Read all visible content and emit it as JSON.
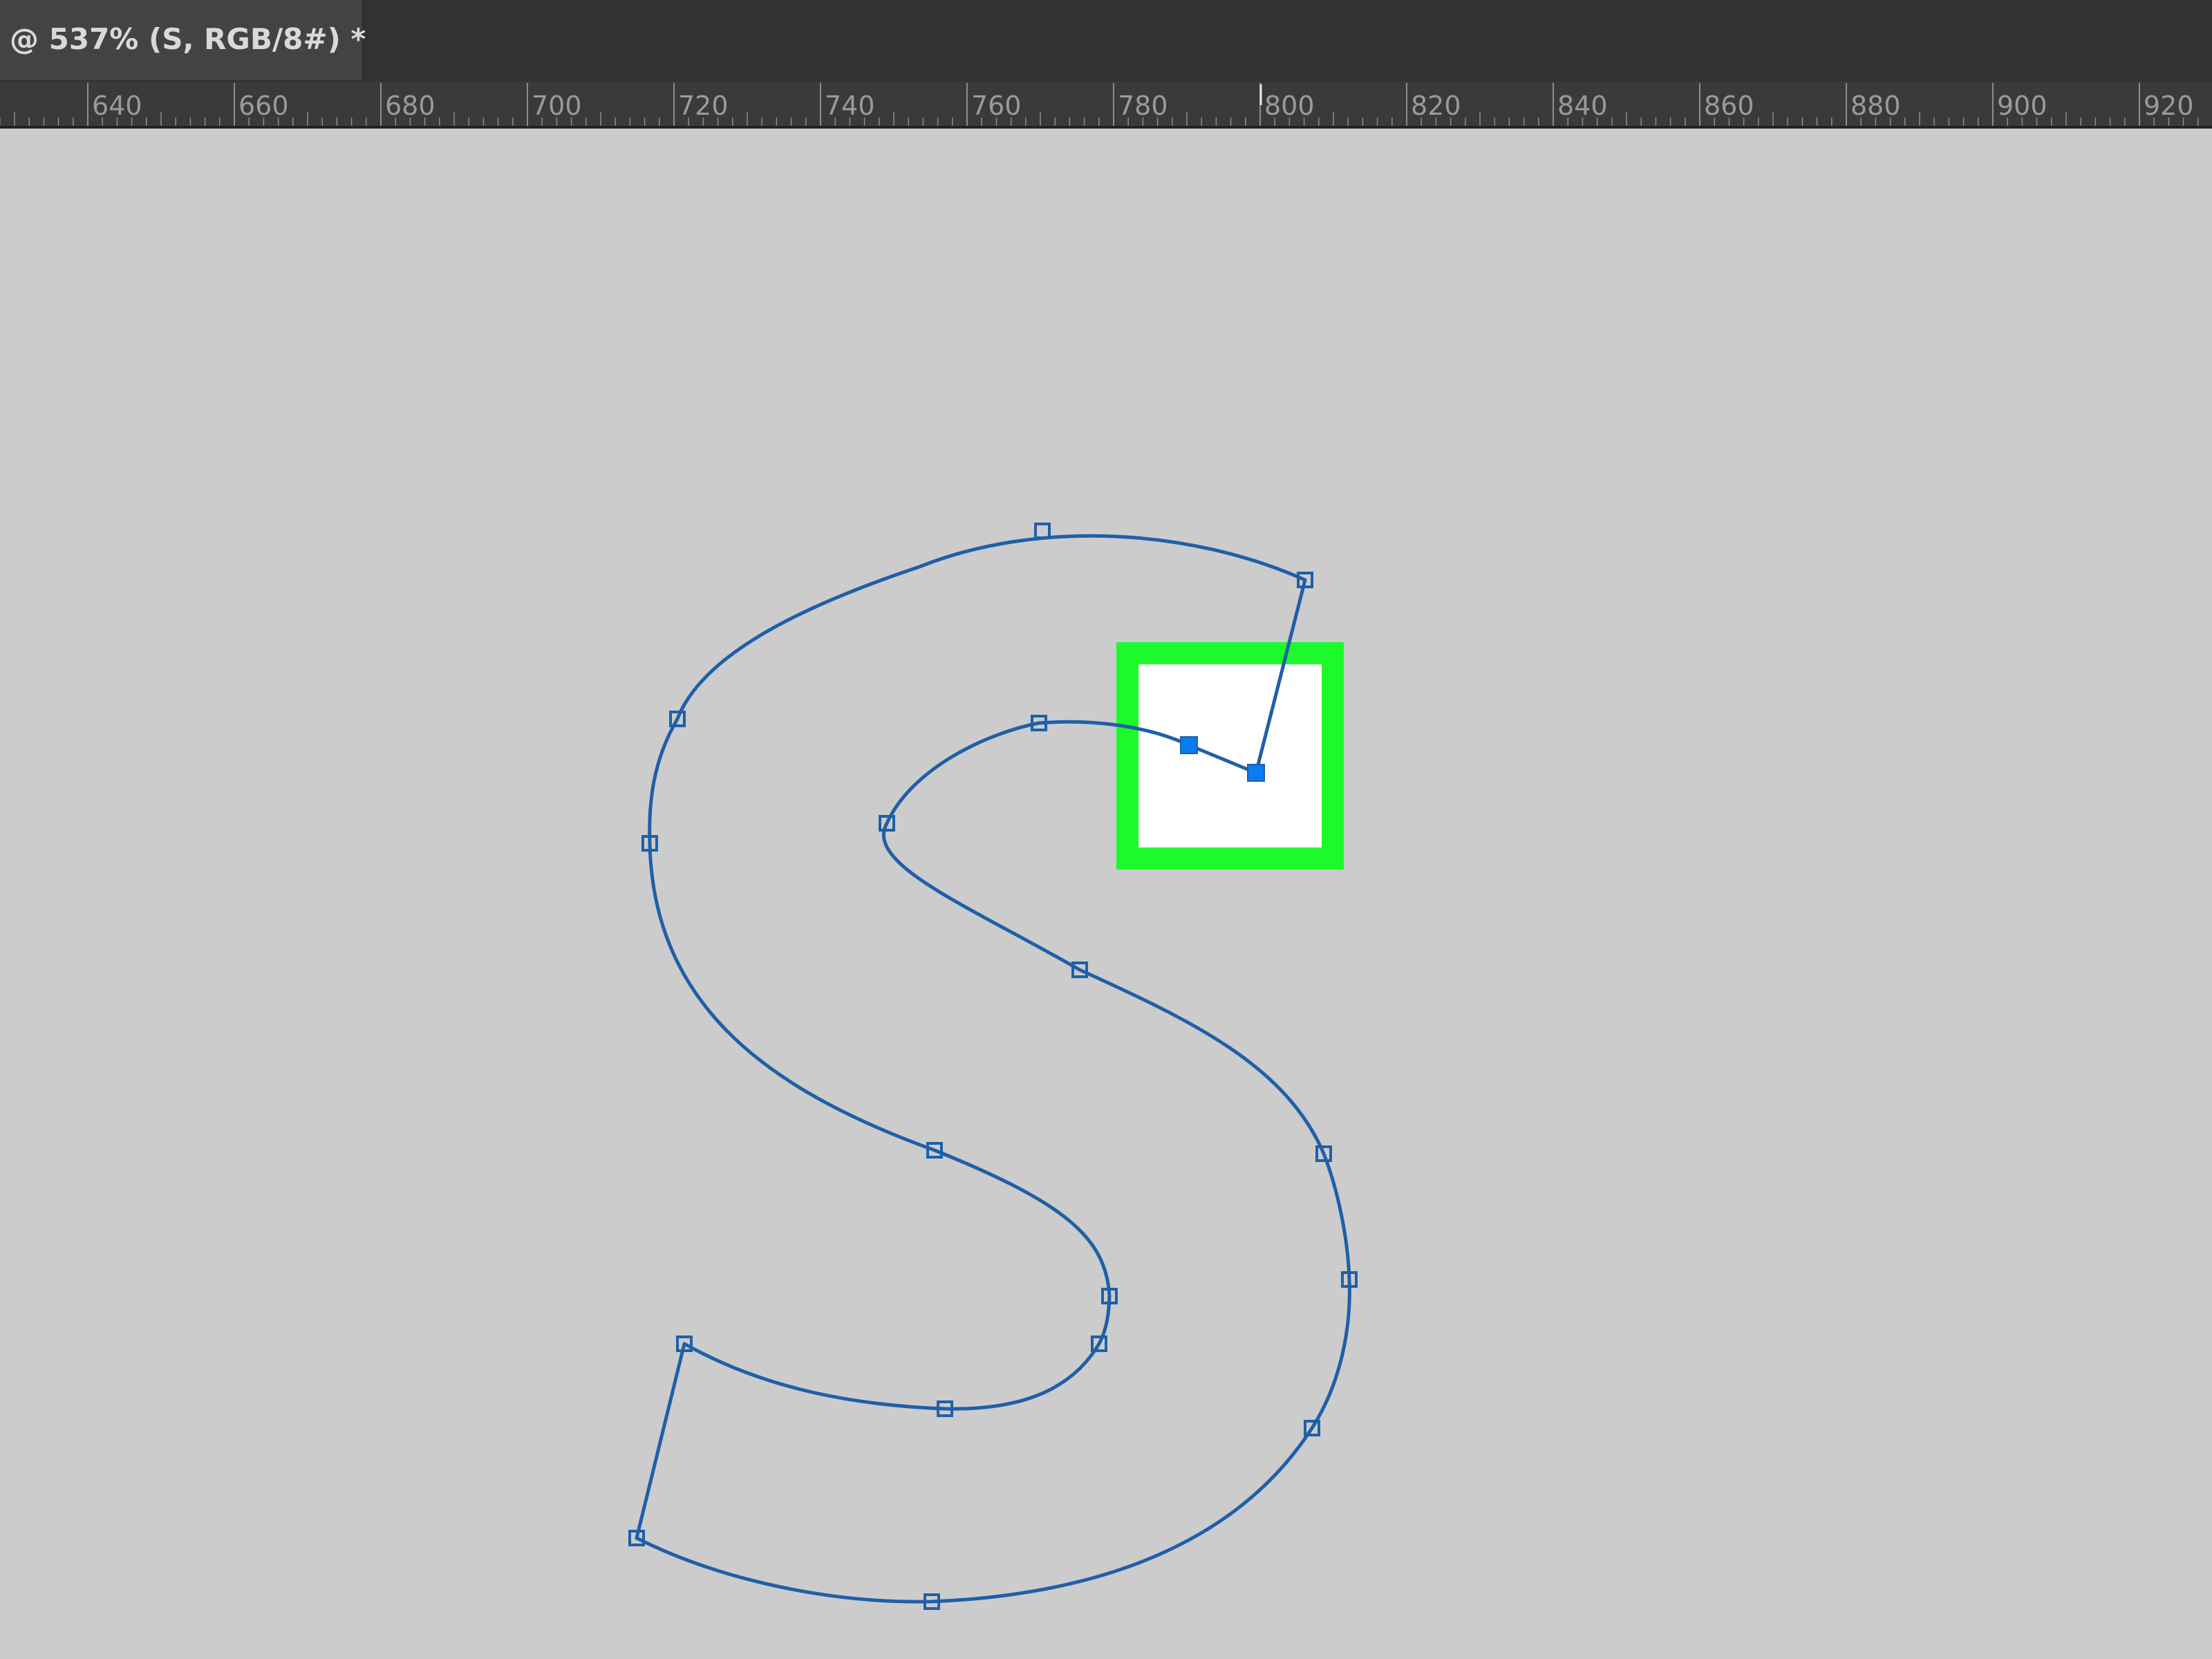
{
  "document_tab": {
    "label": "@ 537% (S, RGB/8#) *"
  },
  "ruler": {
    "labels": [
      "640",
      "660",
      "680",
      "700",
      "720",
      "740",
      "760",
      "780",
      "800",
      "820",
      "840",
      "860",
      "880",
      "900",
      "920"
    ]
  },
  "path": {
    "shape": "S",
    "stroke_color": "#1f5fa8",
    "anchor_fill": "#ffffff",
    "selected_anchor_color": "#0a7cf0"
  },
  "highlight": {
    "color": "#1dfa2c",
    "fill": "#ffffff"
  },
  "icons": {
    "anchor": "square-anchor-icon",
    "selected_anchor": "selected-anchor-icon"
  }
}
